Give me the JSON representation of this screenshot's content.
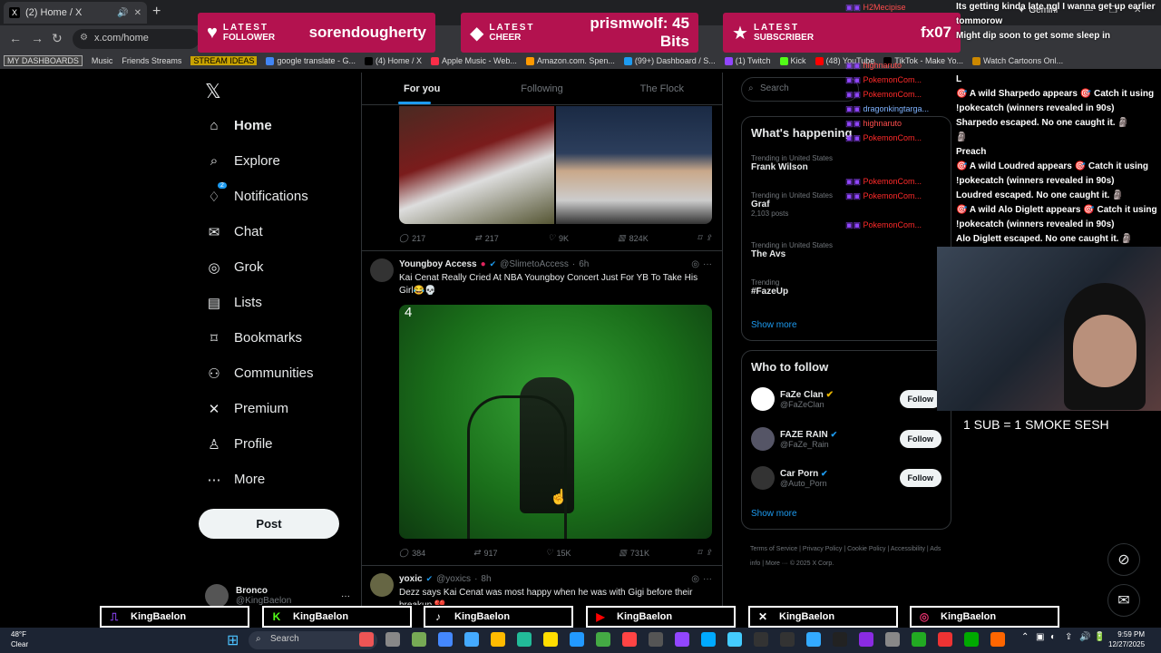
{
  "browser": {
    "tab_title": "(2) Home / X",
    "url": "x.com/home",
    "gemini": "Gemini",
    "bookmarks": [
      "MY DASHBOARDS",
      "Music",
      "Friends Streams",
      "STREAM IDEAS",
      "google translate - G...",
      "(4) Home / X",
      "Apple Music - Web...",
      "Amazon.com. Spen...",
      "(99+) Dashboard / S...",
      "(1) Twitch",
      "Kick",
      "(48) YouTube",
      "TikTok - Make Yo...",
      "Watch Cartoons Onl..."
    ]
  },
  "alerts": [
    {
      "kind1": "LATEST",
      "kind2": "FOLLOWER",
      "value": "sorendougherty",
      "color": "#c2185b"
    },
    {
      "kind1": "LATEST",
      "kind2": "CHEER",
      "value": "prismwolf: 45 Bits",
      "color": "#c2185b"
    },
    {
      "kind1": "LATEST",
      "kind2": "SUBSCRIBER",
      "value": "fx07",
      "color": "#c2185b"
    }
  ],
  "nav": {
    "items": [
      {
        "label": "Home",
        "icon": "home-icon",
        "glyph": "⌂"
      },
      {
        "label": "Explore",
        "icon": "search-icon",
        "glyph": "⌕"
      },
      {
        "label": "Notifications",
        "icon": "bell-icon",
        "glyph": "♢",
        "badge": "2"
      },
      {
        "label": "Chat",
        "icon": "mail-icon",
        "glyph": "✉"
      },
      {
        "label": "Grok",
        "icon": "grok-icon",
        "glyph": "◎"
      },
      {
        "label": "Lists",
        "icon": "list-icon",
        "glyph": "▤"
      },
      {
        "label": "Bookmarks",
        "icon": "bookmark-icon",
        "glyph": "⌑"
      },
      {
        "label": "Communities",
        "icon": "people-icon",
        "glyph": "⚇"
      },
      {
        "label": "Premium",
        "icon": "x-logo-icon",
        "glyph": "✕"
      },
      {
        "label": "Profile",
        "icon": "person-icon",
        "glyph": "♙"
      },
      {
        "label": "More",
        "icon": "more-circle-icon",
        "glyph": "⋯"
      }
    ],
    "post_label": "Post",
    "account_name": "Bronco",
    "account_handle": "@KingBaelon"
  },
  "feed": {
    "tabs": [
      "For you",
      "Following",
      "The Flock"
    ],
    "tweet1": {
      "replies": "217",
      "retweets": "217",
      "likes": "9K",
      "views": "824K"
    },
    "tweet2": {
      "name": "Youngboy Access",
      "handle": "@SlimetoAccess",
      "time": "6h",
      "text": "Kai Cenat Really Cried At NBA Youngboy Concert Just For YB To Take His Girl😂💀",
      "video_counter": "4",
      "replies": "384",
      "retweets": "917",
      "likes": "15K",
      "views": "731K"
    },
    "tweet3": {
      "name": "yoxic",
      "handle": "@yoxics",
      "time": "8h",
      "text": "Dezz says Kai Cenat was most happy when he was with Gigi before their breakup 💔"
    }
  },
  "sidebar": {
    "search_placeholder": "Search",
    "happening_title": "What's happening",
    "trends": [
      {
        "cat": "Trending in United States",
        "name": "Frank Wilson",
        "count": ""
      },
      {
        "cat": "Trending in United States",
        "name": "Graf",
        "count": "2,103 posts"
      },
      {
        "cat": "Trending in United States",
        "name": "The Avs",
        "count": ""
      },
      {
        "cat": "Trending",
        "name": "#FazeUp",
        "count": ""
      }
    ],
    "show_more": "Show more",
    "who_title": "Who to follow",
    "follows": [
      {
        "name": "FaZe Clan",
        "handle": "@FaZeClan",
        "btn": "Follow"
      },
      {
        "name": "FAZE RAIN",
        "handle": "@FaZe_Rain",
        "btn": "Follow"
      },
      {
        "name": "Car Porn",
        "handle": "@Auto_Porn",
        "btn": "Follow"
      }
    ],
    "footer": "Terms of Service | Privacy Policy | Cookie Policy | Accessibility | Ads info | More ··· © 2025 X Corp."
  },
  "chat": {
    "names": [
      "H2Mecipise",
      "",
      "",
      "",
      "highnaruto",
      "PokemonCom...",
      "PokemonCom...",
      "dragonkingtarga...",
      "highnaruto",
      "PokemonCom...",
      "",
      "",
      "PokemonCom...",
      "PokemonCom...",
      "",
      "PokemonCom..."
    ],
    "messages": [
      "Its getting kinda late ngl I wanna get up earlier tommorow",
      "Might dip soon to get some sleep in",
      "",
      "",
      "L",
      "🎯 A wild Sharpedo appears 🎯 Catch it using !pokecatch (winners revealed in 90s)",
      "Sharpedo escaped. No one caught it. 🗿",
      "🗿",
      "Preach",
      "🎯 A wild Loudred appears 🎯 Catch it using !pokecatch (winners revealed in 90s)",
      "Loudred escaped. No one caught it. 🗿",
      "🎯 A wild Alo Diglett appears 🎯 Catch it using !pokecatch (winners revealed in 90s)",
      "Alo Diglett escaped. No one caught it. 🗿"
    ]
  },
  "subgoal": "1 SUB = 1 SMOKE SESH",
  "socials": [
    {
      "platform": "twitch-icon",
      "glyph": "⎍",
      "handle": "KingBaelon"
    },
    {
      "platform": "kick-icon",
      "glyph": "K",
      "handle": "KingBaelon"
    },
    {
      "platform": "tiktok-icon",
      "glyph": "♪",
      "handle": "KingBaelon"
    },
    {
      "platform": "youtube-icon",
      "glyph": "▶",
      "handle": "KingBaelon"
    },
    {
      "platform": "x-icon",
      "glyph": "✕",
      "handle": "KingBaelon"
    },
    {
      "platform": "instagram-icon",
      "glyph": "◎",
      "handle": "KingBaelon"
    }
  ],
  "taskbar": {
    "temp": "48°F",
    "condition": "Clear",
    "search": "Search",
    "time": "9:59 PM",
    "date": "12/27/2025"
  }
}
